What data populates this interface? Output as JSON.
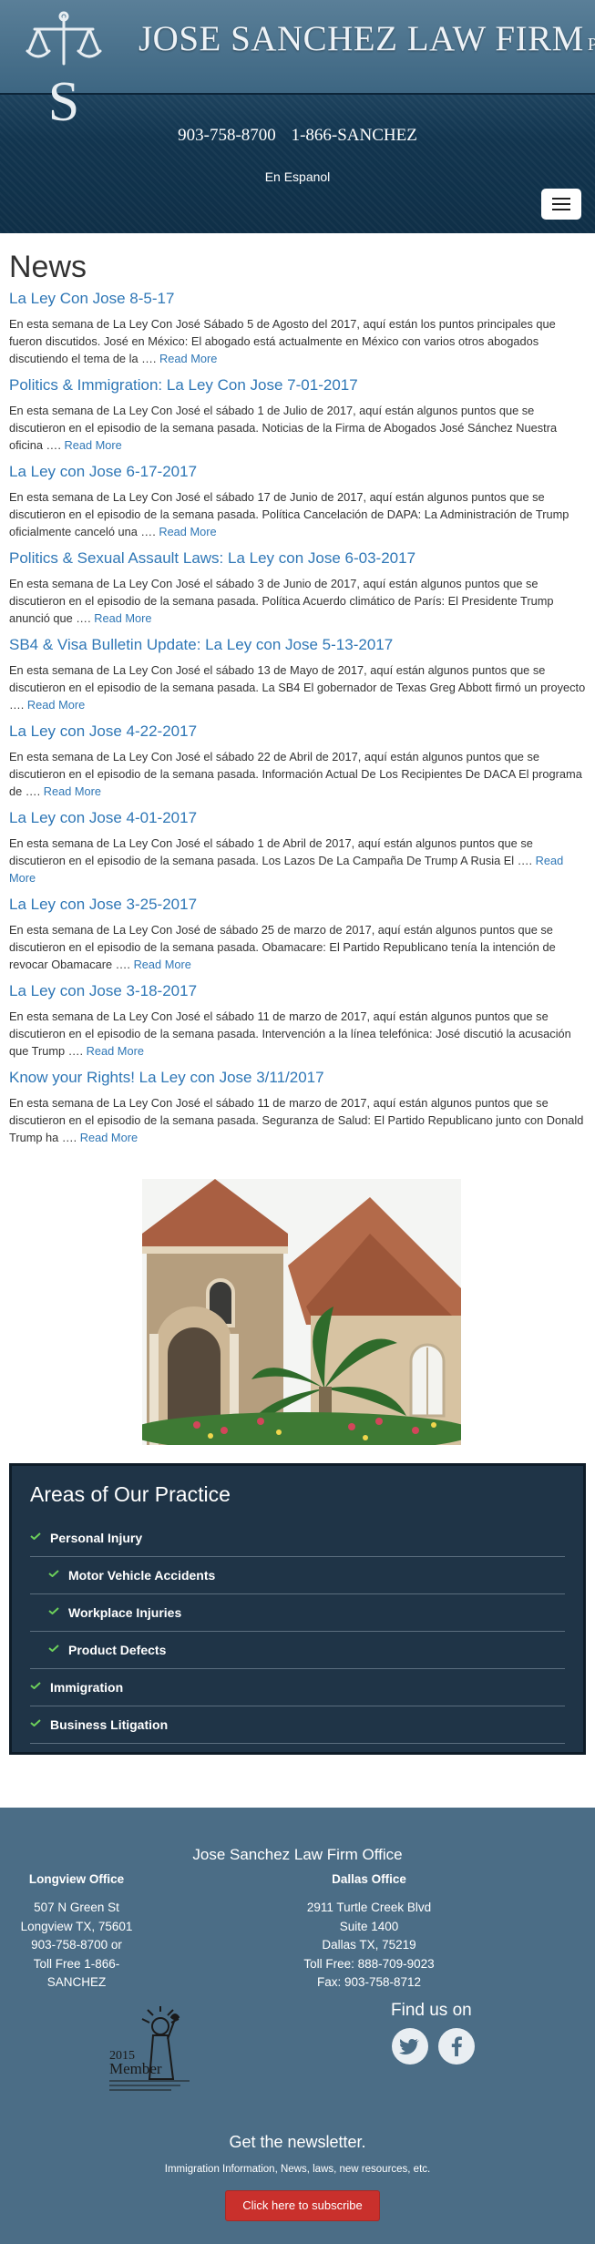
{
  "header": {
    "firm_name": "JOSE SANCHEZ LAW FIRM",
    "firm_suffix": "P.C.",
    "phone_local": "903-758-8700",
    "phone_toll": "1-866-SANCHEZ",
    "language_link": "En Espanol"
  },
  "news": {
    "title": "News",
    "articles": [
      {
        "title": "La Ley Con Jose 8-5-17",
        "body": "En esta semana de La Ley Con José Sábado 5 de Agosto del 2017, aquí están los puntos principales que fueron discutidos. José en México: El abogado está actualmente en México con varios otros abogados discutiendo el tema de la ….",
        "link": "Read More"
      },
      {
        "title": "Politics & Immigration: La Ley Con Jose 7-01-2017",
        "body": "En esta semana de La Ley Con José el sábado 1 de Julio de 2017, aquí están algunos puntos que se discutieron en el episodio de la semana pasada.   Noticias de la Firma de Abogados José Sánchez Nuestra oficina ….",
        "link": "Read More"
      },
      {
        "title": "La Ley con Jose 6-17-2017",
        "body": "En esta semana de La Ley Con José el sábado 17 de Junio de 2017, aquí están algunos puntos que se discutieron en el episodio de la semana pasada. Política Cancelación de DAPA: La Administración de Trump oficialmente canceló una ….",
        "link": "Read More"
      },
      {
        "title": "Politics & Sexual Assault Laws: La Ley con Jose 6-03-2017",
        "body": "En esta semana de La Ley Con José el sábado 3 de Junio de 2017, aquí están algunos puntos que se discutieron en el episodio de la semana pasada.   Política Acuerdo climático de París: El Presidente Trump anunció que ….",
        "link": "Read More"
      },
      {
        "title": "SB4 & Visa Bulletin Update: La Ley con Jose 5-13-2017",
        "body": "En esta semana de La Ley Con José el sábado 13 de Mayo de 2017, aquí están algunos puntos que se discutieron en el episodio de la semana pasada. La SB4 El gobernador de Texas Greg Abbott firmó un proyecto ….",
        "link": "Read More"
      },
      {
        "title": "La Ley con Jose 4-22-2017",
        "body": "En esta semana de La Ley Con José el sábado 22 de Abril de 2017, aquí están algunos puntos que se discutieron en el episodio de la semana pasada.   Información Actual De Los Recipientes De DACA El programa de ….",
        "link": "Read More"
      },
      {
        "title": "La Ley con Jose 4-01-2017",
        "body": "En esta semana de La Ley Con José el sábado 1 de Abril de 2017, aquí están algunos puntos que se discutieron en el episodio de la semana pasada.   Los Lazos De La Campaña De Trump A Rusia El ….",
        "link": "Read More"
      },
      {
        "title": "La Ley con Jose 3-25-2017",
        "body": "En esta semana de La Ley Con José de sábado 25 de marzo de 2017, aquí están algunos puntos que se discutieron en el episodio de la semana pasada.   Obamacare: El Partido Republicano tenía la intención de revocar Obamacare ….",
        "link": "Read More"
      },
      {
        "title": "La Ley con Jose 3-18-2017",
        "body": "En esta semana de La Ley Con José el sábado 11 de marzo de 2017, aquí están algunos puntos que se discutieron en el episodio de la semana pasada. Intervención a la línea telefónica: José discutió la acusación que Trump ….",
        "link": "Read More"
      },
      {
        "title": "Know your Rights! La Ley con Jose 3/11/2017",
        "body": "En esta semana de La Ley Con José el sábado 11 de marzo de 2017, aquí están algunos puntos que se discutieron en el episodio de la semana pasada. Seguranza de Salud: El Partido Republicano junto con Donald Trump ha ….",
        "link": "Read More"
      }
    ]
  },
  "practice": {
    "title": "Areas of Our Practice",
    "items": [
      {
        "label": "Personal Injury",
        "sub": false
      },
      {
        "label": "Motor Vehicle Accidents",
        "sub": true
      },
      {
        "label": "Workplace Injuries",
        "sub": true
      },
      {
        "label": "Product Defects",
        "sub": true
      },
      {
        "label": "Immigration",
        "sub": false
      },
      {
        "label": "Business Litigation",
        "sub": false
      }
    ]
  },
  "footer": {
    "title": "Jose Sanchez Law Firm Office",
    "longview": {
      "heading": "Longview Office",
      "lines": [
        "507 N Green St",
        "Longview TX, 75601",
        "903-758-8700 or",
        "Toll Free 1-866-",
        "SANCHEZ"
      ]
    },
    "dallas": {
      "heading": "Dallas Office",
      "lines": [
        "2911 Turtle Creek Blvd",
        "Suite 1400",
        "Dallas TX, 75219",
        "Toll Free: 888-709-9023",
        "Fax: 903-758-8712"
      ]
    },
    "badge": {
      "year": "2015",
      "word": "Member"
    },
    "find_us": "Find us on",
    "social": [
      "twitter-icon",
      "facebook-icon"
    ],
    "newsletter_title": "Get the newsletter.",
    "newsletter_desc": "Immigration Information, News, laws, new resources, etc.",
    "subscribe_label": "Click here to subscribe"
  },
  "colors": {
    "header_dark": "#12354f",
    "link_blue": "#2f77b6",
    "practice_bg": "#1f3447",
    "check_green": "#6ccf5a",
    "footer_bg": "#4b6d86",
    "subscribe_red": "#c9302c"
  }
}
